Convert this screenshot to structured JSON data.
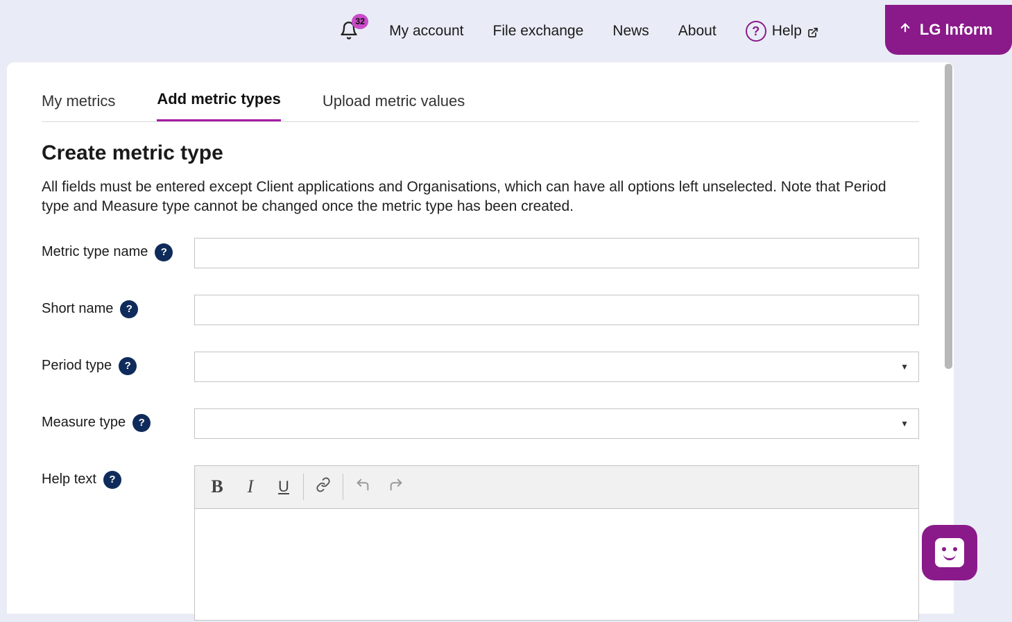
{
  "nav": {
    "notification_count": "32",
    "my_account": "My account",
    "file_exchange": "File exchange",
    "news": "News",
    "about": "About",
    "help": "Help",
    "lg_inform": "LG Inform"
  },
  "tabs": {
    "my_metrics": "My metrics",
    "add_metric_types": "Add metric types",
    "upload_metric_values": "Upload metric values"
  },
  "page": {
    "title": "Create metric type",
    "description": "All fields must be entered except Client applications and Organisations, which can have all options left unselected. Note that Period type and Measure type cannot be changed once the metric type has been created."
  },
  "form": {
    "metric_type_name": {
      "label": "Metric type name",
      "value": ""
    },
    "short_name": {
      "label": "Short name",
      "value": ""
    },
    "period_type": {
      "label": "Period type",
      "value": ""
    },
    "measure_type": {
      "label": "Measure type",
      "value": ""
    },
    "help_text": {
      "label": "Help text",
      "value": ""
    }
  },
  "editor": {
    "bold": "B",
    "italic": "I",
    "underline": "U"
  }
}
